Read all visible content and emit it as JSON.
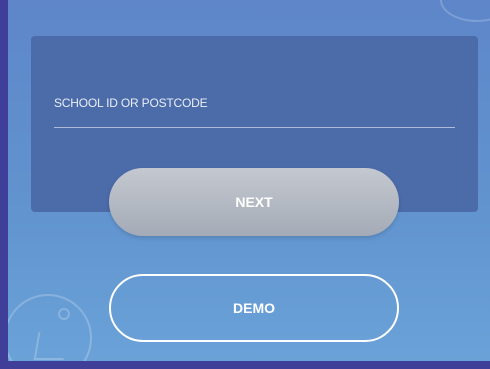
{
  "login": {
    "field_label": "SCHOOL ID OR POSTCODE",
    "next_label": "NEXT",
    "demo_label": "DEMO"
  },
  "colors": {
    "frame": "#3f3f9a",
    "background_top": "#5e86c9",
    "background_bottom": "#6aa2d8",
    "card": "#4b6ba9",
    "next_button": "#b4bac4",
    "text": "#ffffff"
  },
  "icons": [
    "decorative-ring-icon",
    "decorative-swirl-icon"
  ]
}
